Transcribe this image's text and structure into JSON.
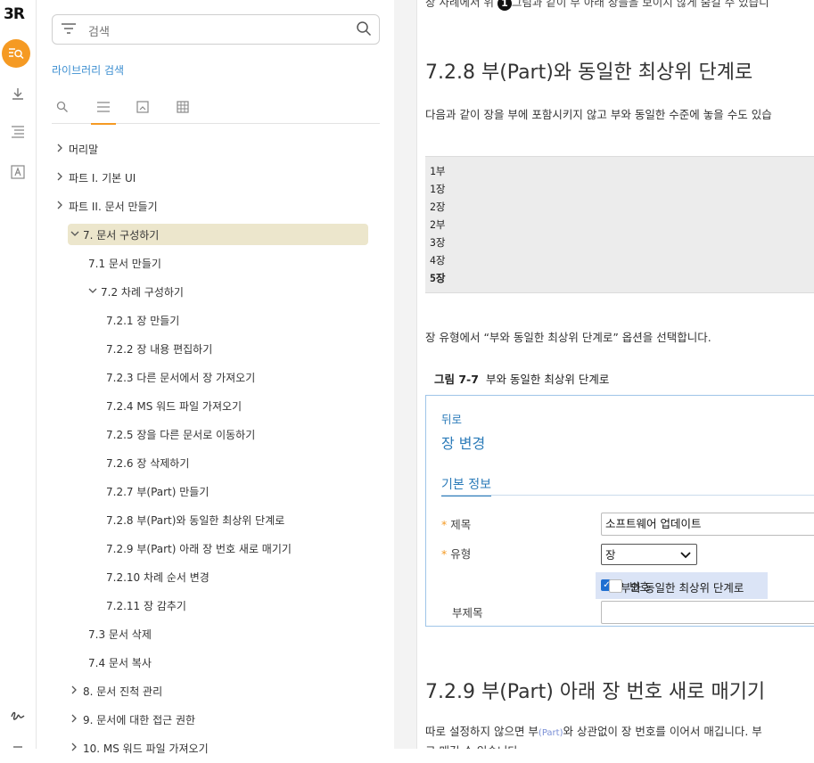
{
  "rail": {
    "logo": "3R"
  },
  "sidebar": {
    "search_placeholder": "검색",
    "library_search_label": "라이브러리 검색",
    "tree": [
      {
        "label": "머리말",
        "indent": 0,
        "chevron": "right"
      },
      {
        "label": "파트 I.  기본 UI",
        "indent": 0,
        "chevron": "right"
      },
      {
        "label": "파트 II.  문서 만들기",
        "indent": 0,
        "chevron": "right"
      },
      {
        "label": "7.  문서 구성하기",
        "indent": 1,
        "chevron": "down",
        "selected": true
      },
      {
        "label": "7.1  문서 만들기",
        "indent": 2,
        "chevron": ""
      },
      {
        "label": "7.2  차례 구성하기",
        "indent": 2,
        "chevron": "down"
      },
      {
        "label": "7.2.1  장 만들기",
        "indent": 3,
        "chevron": ""
      },
      {
        "label": "7.2.2  장 내용 편집하기",
        "indent": 3,
        "chevron": ""
      },
      {
        "label": "7.2.3  다른 문서에서 장 가져오기",
        "indent": 3,
        "chevron": ""
      },
      {
        "label": "7.2.4  MS 워드 파일 가져오기",
        "indent": 3,
        "chevron": ""
      },
      {
        "label": "7.2.5  장을 다른 문서로 이동하기",
        "indent": 3,
        "chevron": ""
      },
      {
        "label": "7.2.6  장 삭제하기",
        "indent": 3,
        "chevron": ""
      },
      {
        "label": "7.2.7  부(Part) 만들기",
        "indent": 3,
        "chevron": ""
      },
      {
        "label": "7.2.8  부(Part)와 동일한 최상위 단계로",
        "indent": 3,
        "chevron": ""
      },
      {
        "label": "7.2.9  부(Part) 아래 장 번호 새로 매기기",
        "indent": 3,
        "chevron": ""
      },
      {
        "label": "7.2.10  차례 순서 변경",
        "indent": 3,
        "chevron": ""
      },
      {
        "label": "7.2.11  장 감추기",
        "indent": 3,
        "chevron": ""
      },
      {
        "label": "7.3  문서 삭제",
        "indent": 2,
        "chevron": ""
      },
      {
        "label": "7.4  문서 복사",
        "indent": 2,
        "chevron": ""
      },
      {
        "label": "8.  문서 진척 관리",
        "indent": 1,
        "chevron": "right"
      },
      {
        "label": "9.  문서에 대한 접근 권한",
        "indent": 1,
        "chevron": "right"
      },
      {
        "label": "10.  MS 워드 파일 가져오기",
        "indent": 1,
        "chevron": "right"
      }
    ]
  },
  "content": {
    "top_line_before": "장 사례에서 위 ",
    "top_line_num": "1",
    "top_line_after": "그림과 같이 부 아래 장들을 보이지 않게 숨길 수 있습니",
    "section_828_title": "7.2.8  부(Part)와 동일한 최상위 단계로",
    "section_828_para": "다음과 같이 장을 부에 포함시키지 않고 부와 동일한 수준에 놓을 수도 있습",
    "code_lines": [
      "1부",
      "  1장",
      "  2장",
      "2부",
      "  3장",
      "  4장",
      "5장"
    ],
    "option_para": "장 유형에서 “부와 동일한 최상위 단계로” 옵션을 선택합니다.",
    "figure_caption_num": "그림 7-7",
    "figure_caption_text": "부와 동일한 최상위 단계로",
    "figure": {
      "back": "뒤로",
      "title": "장 변경",
      "tab": "기본 정보",
      "title_label": "제목",
      "title_value": "소프트웨어 업데이트",
      "type_label": "유형",
      "type_value": "장",
      "checkbox1_label": "부와 동일한 최상위 단계로",
      "checkbox1_checked": true,
      "checkbox2_label": "번호",
      "checkbox2_checked": false,
      "subtitle_label": "부제목"
    },
    "section_829_title": "7.2.9  부(Part) 아래 장 번호 새로 매기기",
    "section_829_para_a": "따로 설정하지 않으면 부",
    "section_829_para_part": "(Part)",
    "section_829_para_b": "와 상관없이 장 번호를 이어서 매깁니다. 부",
    "section_829_para2": "로 매길 수 있습니다"
  }
}
